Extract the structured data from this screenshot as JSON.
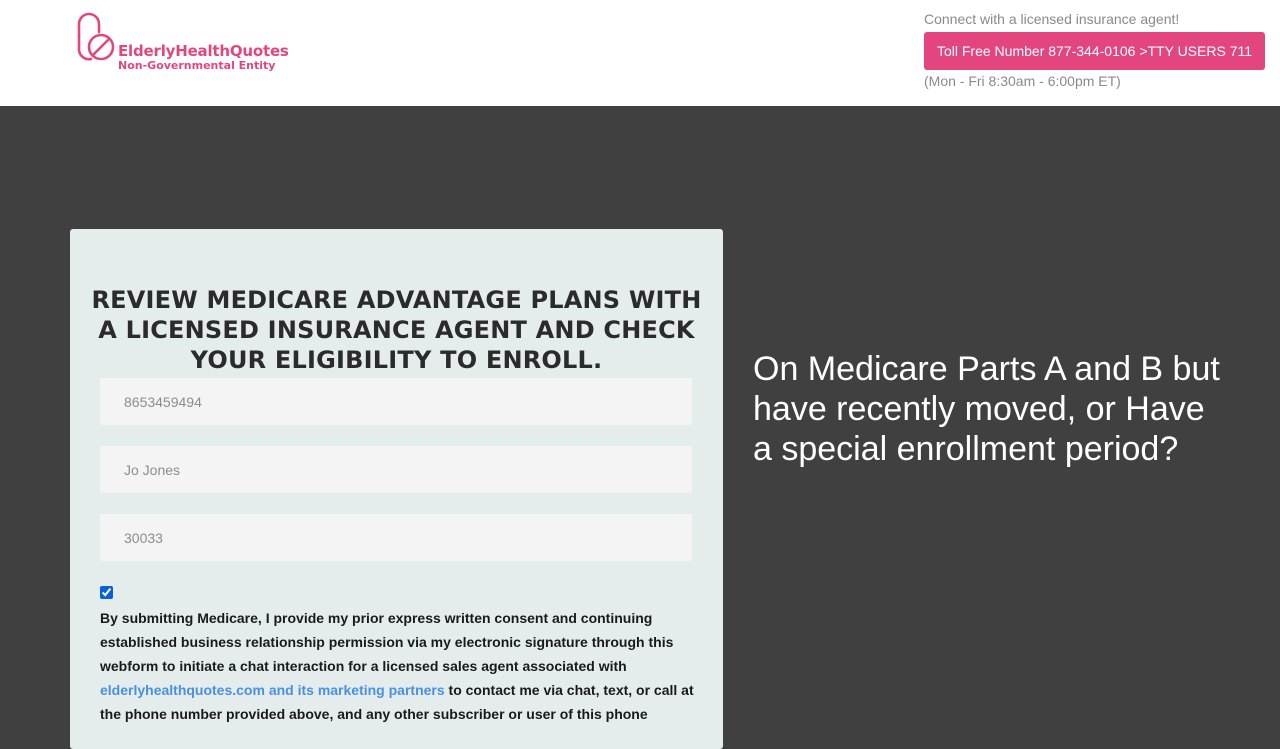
{
  "header": {
    "logo": {
      "icon": "pill-logo-icon",
      "name": "ElderlyHealthQuotes",
      "tagline": "Non-Governmental Entity"
    },
    "contact_prompt": "Connect with a licensed insurance agent!",
    "phone_button_label": "Toll Free Number 877-344-0106 >TTY USERS 711",
    "hours": "(Mon - Fri 8:30am - 6:00pm ET)"
  },
  "form": {
    "title": "REVIEW MEDICARE ADVANTAGE PLANS WITH A LICENSED INSURANCE AGENT AND CHECK YOUR ELIGIBILITY TO ENROLL.",
    "fields": [
      {
        "value": "8653459494"
      },
      {
        "value": "Jo Jones"
      },
      {
        "value": "30033"
      }
    ],
    "consent": {
      "checked": true,
      "text_before": "By submitting Medicare, I provide my prior express written consent and continuing established business relationship permission via my electronic signature through this webform to initiate a chat interaction for a licensed sales agent associated with ",
      "link_text": "elderlyhealthquotes.com and its marketing partners",
      "text_after": " to contact me via chat, text, or call at the phone number provided above, and any other subscriber or user of this phone"
    }
  },
  "hero": {
    "text": "On Medicare Parts A and B but have recently moved, or Have a special enrollment period?"
  },
  "colors": {
    "brand": "#e3467f",
    "background": "#404040",
    "card": "#e5edec",
    "link": "#4a90e2"
  }
}
